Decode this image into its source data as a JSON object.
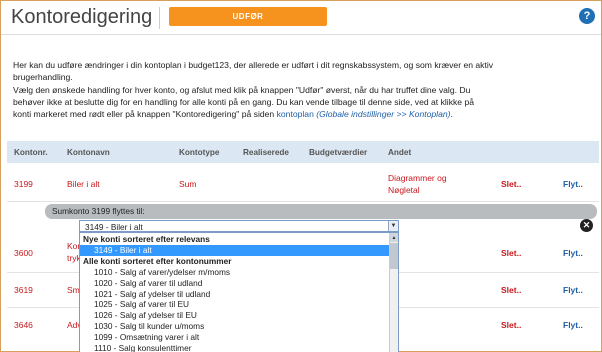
{
  "header": {
    "title": "Kontoredigering",
    "udfor_label": "UDFØR",
    "help_glyph": "?"
  },
  "intro": {
    "line1": "Her kan du udføre ændringer i din kontoplan i budget123, der allerede er udført i dit regnskabssystem, og som kræver en aktiv",
    "line2": "brugerhandling.",
    "line3": "Vælg den ønskede handling for hver konto, og afslut med klik på knappen \"Udfør\" øverst, når du har truffet dine valg. Du",
    "line4": "behøver ikke at beslutte dig for en handling for alle konti på en gang. Du kan vende tilbage til denne side, ved at klikke på",
    "line5_prefix": "konti markeret med rødt eller på knappen \"Kontoredigering\" på siden ",
    "line5_link": "kontoplan",
    "line5_path": "(Globale indstillinger >> Kontoplan)",
    "line5_end": "."
  },
  "table": {
    "columns": [
      "Kontonr.",
      "Kontonavn",
      "Kontotype",
      "Realiserede",
      "Budgetværdier",
      "Andet"
    ],
    "rows": [
      {
        "nr": "3199",
        "name": "Biler i alt",
        "type": "Sum",
        "andet1": "Diagrammer og",
        "andet2": "Nøgletal",
        "slet": "Slet..",
        "flyt": "Flyt.."
      },
      {
        "nr": "3600",
        "name": "Kon",
        "name2": "tryk",
        "slet": "Slet..",
        "flyt": "Flyt.."
      },
      {
        "nr": "3619",
        "name": "Sm",
        "slet": "Slet..",
        "flyt": "Flyt.."
      },
      {
        "nr": "3646",
        "name": "Adv",
        "slet": "Slet..",
        "flyt": "Flyt.."
      }
    ]
  },
  "move": {
    "label": "Sumkonto 3199 flyttes til:",
    "selected": "3149 - Biler i alt",
    "close_glyph": "✕"
  },
  "dropdown": {
    "options": [
      {
        "text": "Nye konti sorteret efter relevans",
        "kind": "group"
      },
      {
        "text": "3149 - Biler i alt",
        "kind": "selected"
      },
      {
        "text": "Alle konti sorteret efter kontonummer",
        "kind": "group"
      },
      {
        "text": "1010 - Salg af varer/ydelser m/moms",
        "kind": "option"
      },
      {
        "text": "1020 - Salg af varer til udland",
        "kind": "option"
      },
      {
        "text": "1021 - Salg af ydelser til udland",
        "kind": "option"
      },
      {
        "text": "1025 - Salg af varer til EU",
        "kind": "option"
      },
      {
        "text": "1026 - Salg af ydelser til EU",
        "kind": "option"
      },
      {
        "text": "1030 - Salg til kunder u/moms",
        "kind": "option"
      },
      {
        "text": "1099 - Omsætning varer i alt",
        "kind": "option"
      },
      {
        "text": "1110 - Salg konsulenttimer",
        "kind": "option"
      }
    ]
  },
  "colors": {
    "accent": "#f6921e",
    "link": "#1f5fa8",
    "danger": "#c8171c",
    "header_row": "#dbe7f2",
    "selection": "#3399ff"
  }
}
